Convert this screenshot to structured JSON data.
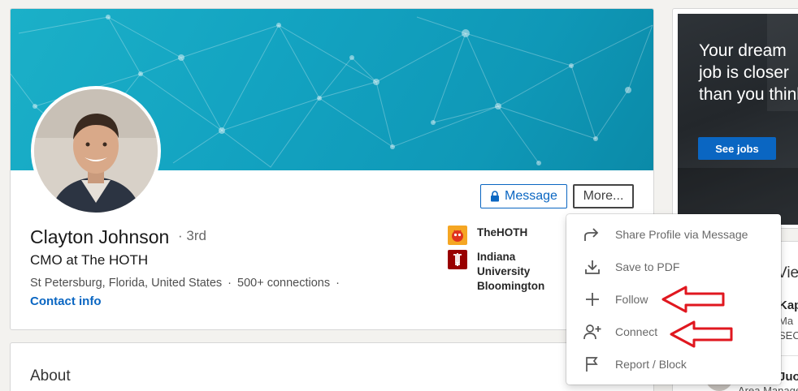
{
  "profile": {
    "name": "Clayton Johnson",
    "degree": "· 3rd",
    "headline": "CMO at The HOTH",
    "location": "St Petersburg, Florida, United States",
    "connections": "500+ connections",
    "separator": "·",
    "contact_info": "Contact info"
  },
  "actions": {
    "message_label": "Message",
    "more_label": "More..."
  },
  "companies": [
    {
      "label": "TheHOTH",
      "color": "#f5a623"
    },
    {
      "label": "Indiana University Bloomington",
      "color": "#990000"
    }
  ],
  "about": {
    "title": "About"
  },
  "ad": {
    "headline": "Your dream job is closer than you think",
    "button_label": "See jobs"
  },
  "sidebar": {
    "fragment_title": "Vie",
    "people": [
      {
        "name": "Kap",
        "line1": "Ma",
        "line2": "SEC"
      },
      {
        "name": "Juo",
        "line1": "Area Manager"
      }
    ]
  },
  "dropdown": {
    "items": [
      {
        "label": "Share Profile via Message",
        "icon": "share-arrow-icon"
      },
      {
        "label": "Save to PDF",
        "icon": "download-icon"
      },
      {
        "label": "Follow",
        "icon": "plus-icon"
      },
      {
        "label": "Connect",
        "icon": "add-person-icon"
      },
      {
        "label": "Report / Block",
        "icon": "flag-icon"
      }
    ]
  },
  "colors": {
    "brand_blue": "#0a66c2",
    "banner": "#13a3c1",
    "annotation_red": "#e0171f"
  }
}
